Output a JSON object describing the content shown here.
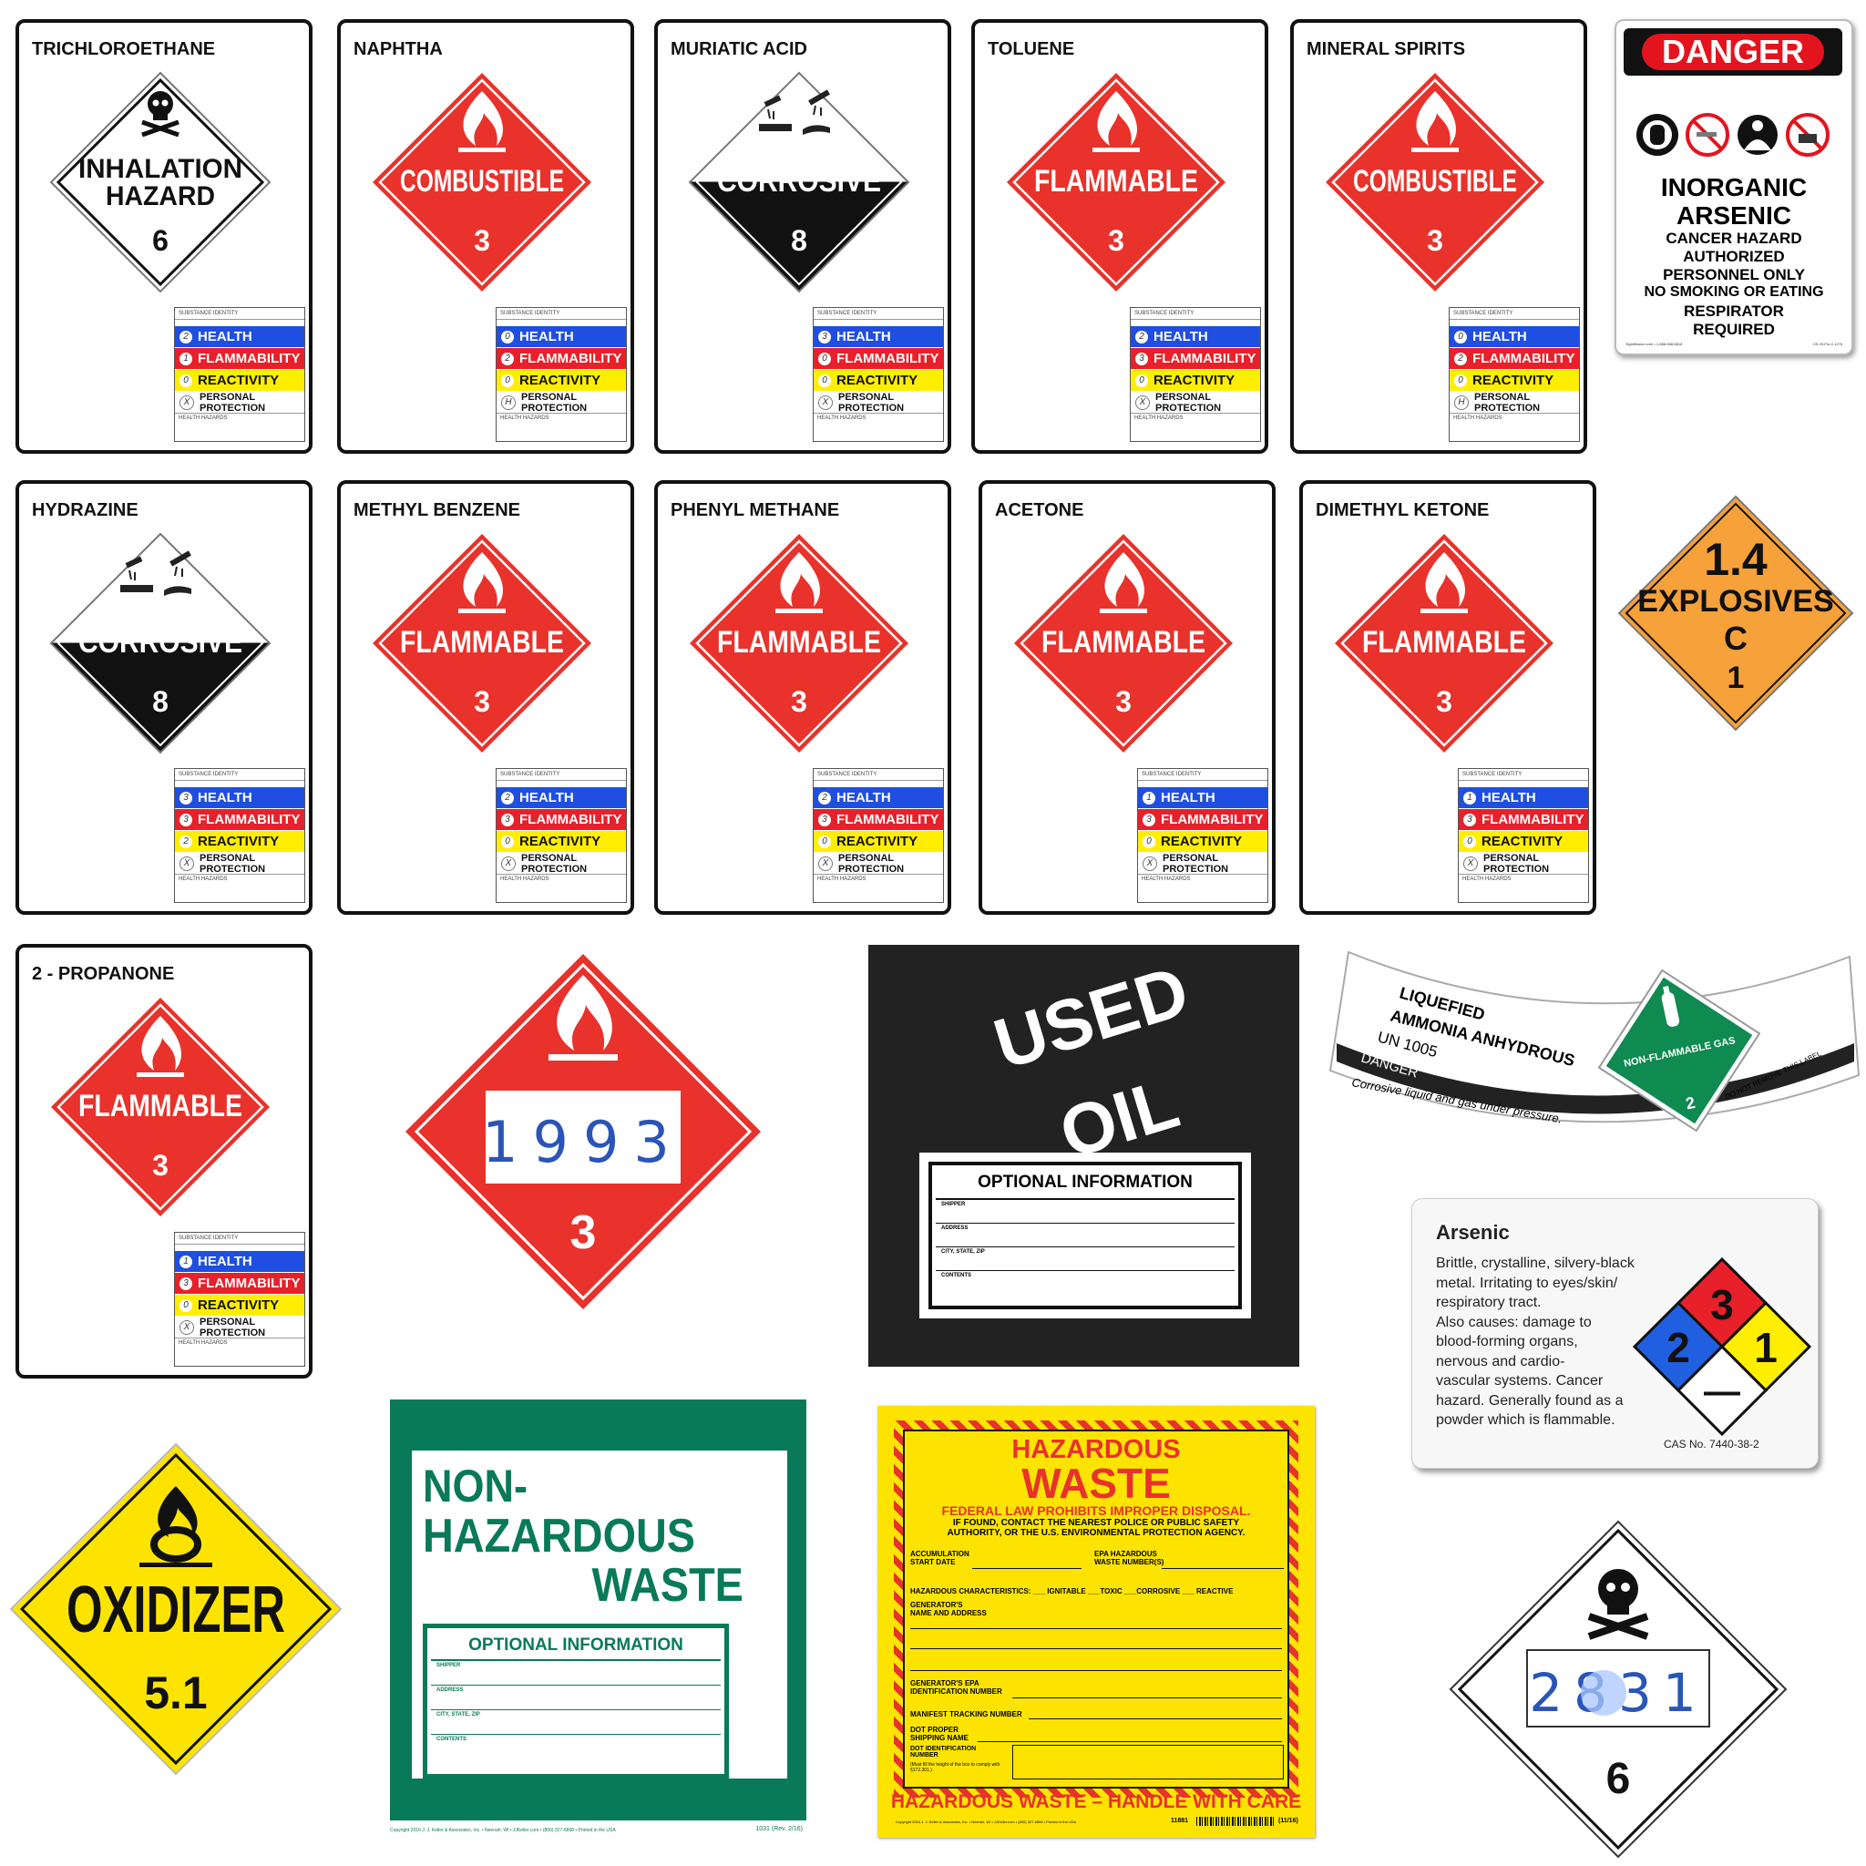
{
  "cards": [
    {
      "title": "TRICHLOROETHANE",
      "placard": {
        "style": "white",
        "icon": "skull-crossbones-icon",
        "lines": [
          "INHALATION",
          "HAZARD"
        ],
        "number": "6"
      },
      "nfpa": {
        "substance_identity": "SUBSTANCE IDENTITY",
        "health": "2",
        "flammability": "1",
        "reactivity": "0",
        "protection": "X",
        "health_hazards": "HEALTH HAZARDS"
      }
    },
    {
      "title": "NAPHTHA",
      "placard": {
        "style": "red",
        "icon": "flame-icon",
        "lines": [
          "COMBUSTIBLE"
        ],
        "number": "3"
      },
      "nfpa": {
        "substance_identity": "SUBSTANCE IDENTITY",
        "health": "0",
        "flammability": "2",
        "reactivity": "0",
        "protection": "H",
        "health_hazards": "HEALTH HAZARDS"
      }
    },
    {
      "title": "MURIATIC ACID",
      "placard": {
        "style": "corrosive",
        "icon": "corrosion-icon",
        "lines": [
          "CORROSIVE"
        ],
        "number": "8"
      },
      "nfpa": {
        "substance_identity": "SUBSTANCE IDENTITY",
        "health": "3",
        "flammability": "0",
        "reactivity": "0",
        "protection": "X",
        "health_hazards": "HEALTH HAZARDS"
      }
    },
    {
      "title": "TOLUENE",
      "placard": {
        "style": "red",
        "icon": "flame-icon",
        "lines": [
          "FLAMMABLE"
        ],
        "number": "3"
      },
      "nfpa": {
        "substance_identity": "SUBSTANCE IDENTITY",
        "health": "2",
        "flammability": "3",
        "reactivity": "0",
        "protection": "X",
        "health_hazards": "HEALTH HAZARDS"
      }
    },
    {
      "title": "MINERAL SPIRITS",
      "placard": {
        "style": "red",
        "icon": "flame-icon",
        "lines": [
          "COMBUSTIBLE"
        ],
        "number": "3"
      },
      "nfpa": {
        "substance_identity": "SUBSTANCE IDENTITY",
        "health": "0",
        "flammability": "2",
        "reactivity": "0",
        "protection": "H",
        "health_hazards": "HEALTH HAZARDS"
      }
    },
    {
      "title": "HYDRAZINE",
      "placard": {
        "style": "corrosive",
        "icon": "corrosion-icon",
        "lines": [
          "CORROSIVE"
        ],
        "number": "8"
      },
      "nfpa": {
        "substance_identity": "SUBSTANCE IDENTITY",
        "health": "3",
        "flammability": "3",
        "reactivity": "2",
        "protection": "X",
        "health_hazards": "HEALTH HAZARDS"
      }
    },
    {
      "title": "METHYL BENZENE",
      "placard": {
        "style": "red",
        "icon": "flame-icon",
        "lines": [
          "FLAMMABLE"
        ],
        "number": "3"
      },
      "nfpa": {
        "substance_identity": "SUBSTANCE IDENTITY",
        "health": "2",
        "flammability": "3",
        "reactivity": "0",
        "protection": "X",
        "health_hazards": "HEALTH HAZARDS"
      }
    },
    {
      "title": "PHENYL METHANE",
      "placard": {
        "style": "red",
        "icon": "flame-icon",
        "lines": [
          "FLAMMABLE"
        ],
        "number": "3"
      },
      "nfpa": {
        "substance_identity": "SUBSTANCE IDENTITY",
        "health": "2",
        "flammability": "3",
        "reactivity": "0",
        "protection": "X",
        "health_hazards": "HEALTH HAZARDS"
      }
    },
    {
      "title": "ACETONE",
      "placard": {
        "style": "red",
        "icon": "flame-icon",
        "lines": [
          "FLAMMABLE"
        ],
        "number": "3"
      },
      "nfpa": {
        "substance_identity": "SUBSTANCE IDENTITY",
        "health": "1",
        "flammability": "3",
        "reactivity": "0",
        "protection": "X",
        "health_hazards": "HEALTH HAZARDS"
      }
    },
    {
      "title": "DIMETHYL KETONE",
      "placard": {
        "style": "red",
        "icon": "flame-icon",
        "lines": [
          "FLAMMABLE"
        ],
        "number": "3"
      },
      "nfpa": {
        "substance_identity": "SUBSTANCE IDENTITY",
        "health": "1",
        "flammability": "3",
        "reactivity": "0",
        "protection": "X",
        "health_hazards": "HEALTH HAZARDS"
      }
    },
    {
      "title": "2 - PROPANONE",
      "placard": {
        "style": "red",
        "icon": "flame-icon",
        "lines": [
          "FLAMMABLE"
        ],
        "number": "3"
      },
      "nfpa": {
        "substance_identity": "SUBSTANCE IDENTITY",
        "health": "1",
        "flammability": "3",
        "reactivity": "0",
        "protection": "X",
        "health_hazards": "HEALTH HAZARDS"
      }
    }
  ],
  "nfpa_labels": {
    "health": "HEALTH",
    "flammability": "FLAMMABILITY",
    "reactivity": "REACTIVITY",
    "protection": "PERSONAL PROTECTION"
  },
  "danger_sign": {
    "header": "DANGER",
    "lines": [
      "INORGANIC",
      "ARSENIC"
    ],
    "small_lines": [
      "CANCER HAZARD",
      "AUTHORIZED",
      "PERSONNEL ONLY",
      "NO SMOKING OR EATING",
      "RESPIRATOR",
      "REQUIRED"
    ],
    "footer_left": "SignMission.com • 1-888-588-8818",
    "footer_right": "OS-29-Pw-V-1276"
  },
  "explosives": {
    "division": "1.4",
    "label": "EXPLOSIVES",
    "group": "C",
    "number": "1"
  },
  "placard_1993": {
    "un_number": "1993",
    "number": "3"
  },
  "used_oil": {
    "line1": "USED",
    "line2": "OIL",
    "box_title": "OPTIONAL INFORMATION",
    "fields": [
      "SHIPPER",
      "ADDRESS",
      "CITY, STATE, ZIP",
      "CONTENTS"
    ]
  },
  "ammonia": {
    "line1": "LIQUEFIED",
    "line2": "AMMONIA ANHYDROUS",
    "un": "UN 1005",
    "signal": "DANGER",
    "hazard": "Corrosive liquid and gas under pressure.",
    "placard": "NON-FLAMMABLE GAS",
    "number": "2",
    "note": "DO NOT REMOVE THIS LABEL"
  },
  "arsenic_label": {
    "title": "Arsenic",
    "lines": [
      "Brittle, crystalline, silvery-black",
      "metal. Irritating to eyes/skin/",
      "respiratory tract.",
      "Also causes: damage to",
      "blood-forming organs,",
      "nervous and cardio-",
      "vascular systems. Cancer",
      "hazard. Generally found as a",
      "powder which is flammable."
    ],
    "cas": "CAS No. 7440-38-2",
    "nfpa": {
      "health": "2",
      "flammability": "3",
      "reactivity": "1",
      "special": "—"
    }
  },
  "oxidizer": {
    "label": "OXIDIZER",
    "number": "5.1"
  },
  "non_haz": {
    "lines": [
      "NON-",
      "HAZARDOUS",
      "WASTE"
    ],
    "box_title": "OPTIONAL INFORMATION",
    "fields": [
      "SHIPPER",
      "ADDRESS",
      "CITY, STATE, ZIP",
      "CONTENTS"
    ],
    "footer_left": "Copyright 2016 J. J. Keller & Associates, Inc. • Neenah, WI • JJKeller.com • (800) 327-6868 • Printed in the USA",
    "footer_right": "1031 (Rev. 2/16)"
  },
  "haz_waste": {
    "title1": "HAZARDOUS",
    "title2": "WASTE",
    "subtitle": "FEDERAL LAW PROHIBITS IMPROPER DISPOSAL.",
    "notice1": "IF FOUND, CONTACT THE NEAREST POLICE OR PUBLIC SAFETY",
    "notice2": "AUTHORITY, OR THE U.S. ENVIRONMENTAL PROTECTION AGENCY.",
    "acc": "ACCUMULATION",
    "start": "START DATE",
    "epa1": "EPA HAZARDOUS",
    "epa2": "WASTE NUMBER(S)",
    "chars": "HAZARDOUS CHARACTERISTICS: ___ IGNITABLE ___TOXIC ___CORROSIVE ___ REACTIVE",
    "gen1": "GENERATOR'S",
    "gen2": "NAME AND ADDRESS",
    "epaid1": "GENERATOR'S EPA",
    "epaid2": "IDENTIFICATION NUMBER",
    "manifest": "MANIFEST TRACKING NUMBER",
    "dot1": "DOT PROPER",
    "dot2": "SHIPPING NAME",
    "dotid1": "DOT IDENTIFICATION",
    "dotid2": "NUMBER",
    "dotnote": "(Must fill the height of the box to comply with §172.301.)",
    "footer": "HAZARDOUS WASTE – HANDLE WITH CARE",
    "copyright": "Copyright 2016 J. J. Keller & Associates, Inc. • Neenah, WI • JJKeller.com • (800) 327-6868 • Printed in the USA",
    "code": "11881",
    "rev": "(11/16)"
  },
  "placard_2831": {
    "un_number": "2831",
    "number": "6"
  }
}
